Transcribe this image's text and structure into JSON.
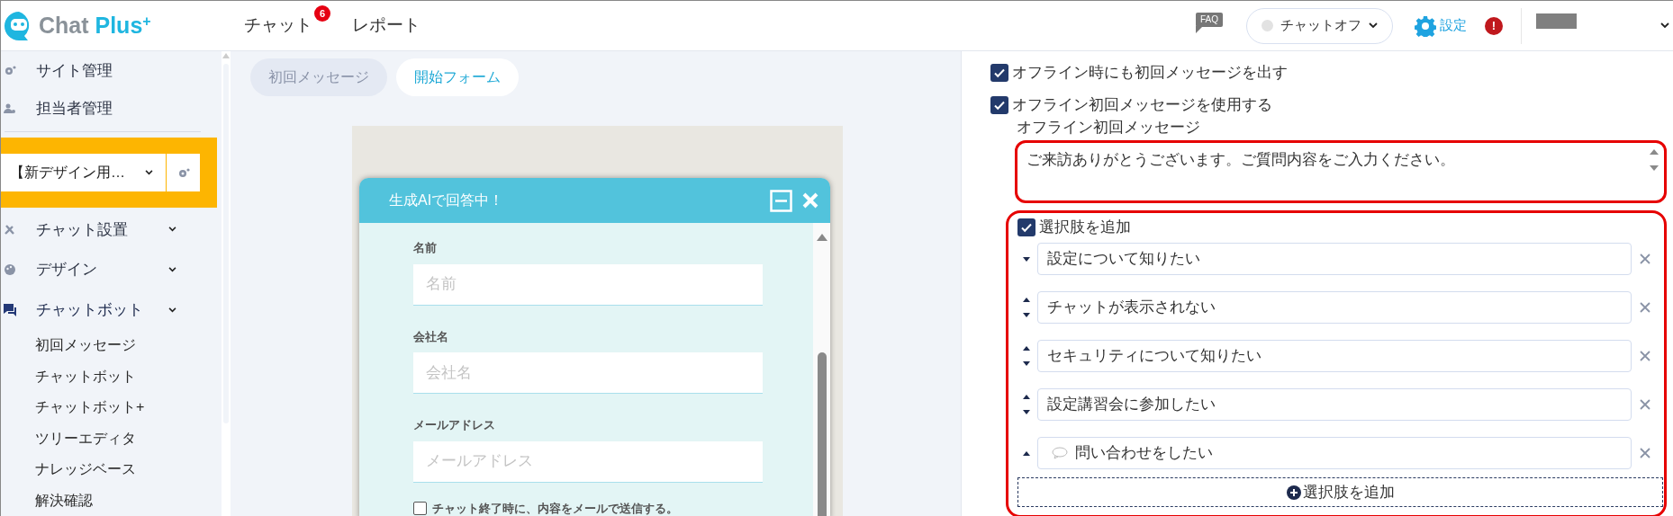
{
  "header": {
    "logo": {
      "name": "Chat",
      "accent": "Plus",
      "sup": "+"
    },
    "nav": [
      {
        "label": "チャット",
        "badge": "6"
      },
      {
        "label": "レポート"
      }
    ],
    "faq": "FAQ",
    "chat_status": {
      "label": "チャットオフ",
      "on": false
    },
    "settings": "設定",
    "alert": "!"
  },
  "sidebar": {
    "admin_items": [
      {
        "label": "サイト管理"
      },
      {
        "label": "担当者管理"
      }
    ],
    "site_selector": {
      "value": "【新デザイン用…"
    },
    "menu": [
      {
        "label": "チャット設置",
        "selected": false,
        "expanded": false
      },
      {
        "label": "デザイン",
        "selected": false,
        "expanded": false
      },
      {
        "label": "チャットボット",
        "selected": true,
        "expanded": true,
        "children": [
          {
            "label": "初回メッセージ"
          },
          {
            "label": "チャットボット"
          },
          {
            "label": "チャットボット+"
          },
          {
            "label": "ツリーエディタ"
          },
          {
            "label": "ナレッジベース"
          },
          {
            "label": "解決確認"
          }
        ]
      }
    ]
  },
  "tabs": [
    {
      "label": "初回メッセージ",
      "selected": false
    },
    {
      "label": "開始フォーム",
      "selected": true
    }
  ],
  "widget": {
    "title": "生成AIで回答中！",
    "fields": [
      {
        "label": "名前",
        "placeholder": "名前"
      },
      {
        "label": "会社名",
        "placeholder": "会社名"
      },
      {
        "label": "メールアドレス",
        "placeholder": "メールアドレス"
      }
    ],
    "mail_option": {
      "label": "チャット終了時に、内容をメールで送信する。",
      "checked": false
    }
  },
  "settings_panel": {
    "options": [
      {
        "label": "オフライン時にも初回メッセージを出す",
        "checked": true
      },
      {
        "label": "オフライン初回メッセージを使用する",
        "checked": true
      }
    ],
    "offline_message": {
      "label": "オフライン初回メッセージ",
      "value": "ご来訪ありがとうございます。ご質問内容をご入力ください。"
    },
    "choices": {
      "toggle": {
        "label": "選択肢を追加",
        "checked": true
      },
      "items": [
        {
          "text": "設定について知りたい",
          "kind": "text",
          "up": false,
          "down": true
        },
        {
          "text": "チャットが表示されない",
          "kind": "text",
          "up": true,
          "down": true
        },
        {
          "text": "セキュリティについて知りたい",
          "kind": "text",
          "up": true,
          "down": true
        },
        {
          "text": "設定講習会に参加したい",
          "kind": "text",
          "up": true,
          "down": true
        },
        {
          "text": "問い合わせをしたい",
          "kind": "message",
          "up": true,
          "down": false
        }
      ],
      "add_button": "選択肢を追加"
    }
  }
}
